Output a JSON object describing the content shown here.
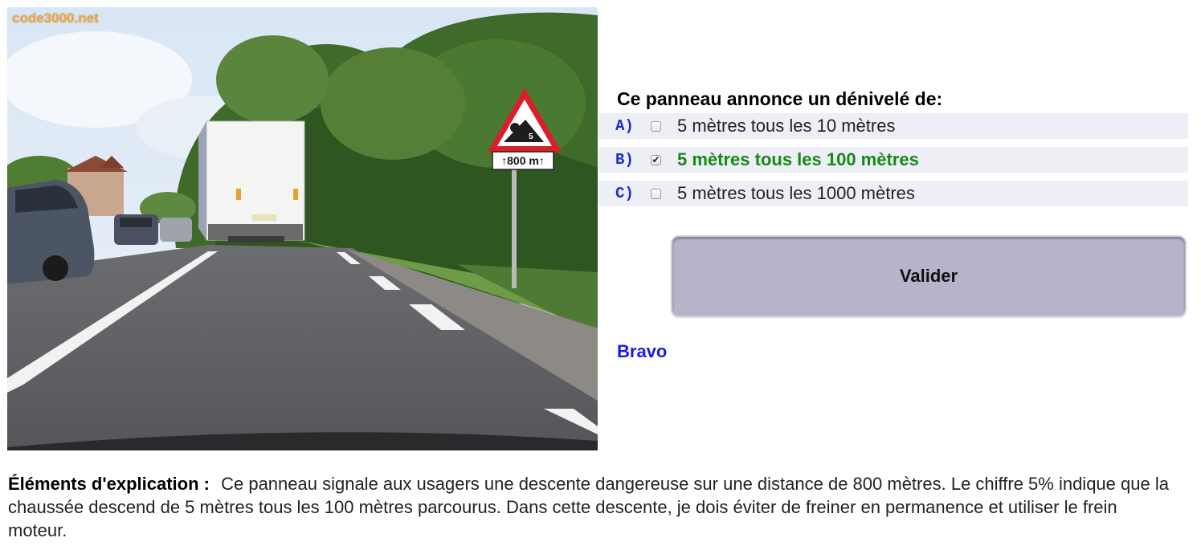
{
  "photo": {
    "watermark": "code3000.net",
    "sign_plate_text": "800 m",
    "sign_icon": "steep-descent-warning-sign"
  },
  "quiz": {
    "question": "Ce panneau annonce un dénivelé de:",
    "answers": [
      {
        "letter": "A)",
        "text": "5 mètres tous les 10 mètres",
        "checked": false,
        "correct": false
      },
      {
        "letter": "B)",
        "text": "5 mètres tous les 100 mètres",
        "checked": true,
        "correct": true
      },
      {
        "letter": "C)",
        "text": "5 mètres tous les 1000 mètres",
        "checked": false,
        "correct": false
      }
    ],
    "submit_label": "Valider",
    "result": "Bravo"
  },
  "explanation": {
    "label": "Éléments d'explication :",
    "text": "Ce panneau signale aux usagers une descente dangereuse sur une distance de 800 mètres. Le chiffre 5% indique que la chaussée descend de 5 mètres tous les 100 mètres parcourus. Dans cette descente, je dois éviter de freiner en permanence et utiliser le frein moteur."
  },
  "colors": {
    "correct_answer": "#158a15",
    "result_text": "#1a1aee",
    "answer_letter": "#1f2fbf",
    "button_bg": "#b6b4ca"
  }
}
